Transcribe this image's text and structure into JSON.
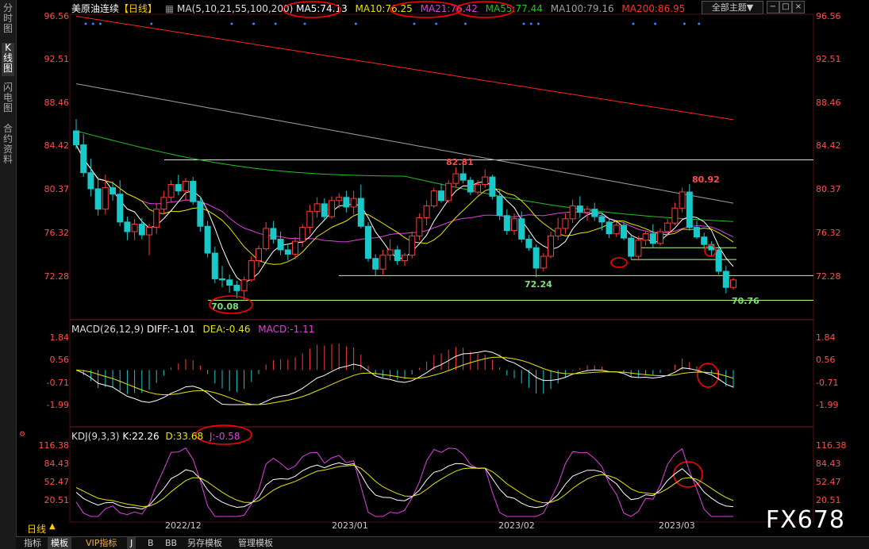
{
  "sidebar": {
    "tabs": [
      {
        "label": "分时图",
        "active": false
      },
      {
        "label": "K线图",
        "active": true
      },
      {
        "label": "闪电图",
        "active": false
      },
      {
        "label": "合约资料",
        "active": false
      }
    ]
  },
  "header": {
    "instrument": "美原油连续",
    "period_tag": "【日线】",
    "ma_params": "MA(5,10,21,55,100,200)",
    "ma5": "MA5:74.13",
    "ma10": "MA10:76.25",
    "ma21": "MA21:76.42",
    "ma55": "MA55:77.44",
    "ma100": "MA100:79.16",
    "ma200": "MA200:86.95",
    "theme_button": "全部主题▼",
    "win_buttons": [
      "−",
      "□",
      "×"
    ]
  },
  "colors": {
    "up": "#ff3b3b",
    "down": "#19c9c9",
    "ma5": "#ffffff",
    "ma10": "#e6e600",
    "ma21": "#e040e0",
    "ma55": "#22c322",
    "ma100": "#a0a0a0",
    "ma200": "#ff2020",
    "level_line": "#b4ff80",
    "annotation_circle": "#ff0000",
    "axis_text": "#ff4d4d"
  },
  "price_axis": [
    "96.56",
    "92.51",
    "88.46",
    "84.42",
    "80.37",
    "76.32",
    "72.28"
  ],
  "price_annotations": [
    {
      "label": "82.81",
      "color": "#ff4d4d"
    },
    {
      "label": "80.92",
      "color": "#ff4d4d"
    },
    {
      "label": "72.24",
      "color": "#7de07d"
    },
    {
      "label": "70.08",
      "color": "#7de07d"
    },
    {
      "label": "70.76",
      "color": "#7de07d"
    }
  ],
  "macd": {
    "title": "MACD(26,12,9)",
    "diff": "DIFF:-1.01",
    "dea": "DEA:-0.46",
    "macd": "MACD:-1.11",
    "axis": [
      "1.84",
      "0.56",
      "-0.71",
      "-1.99"
    ]
  },
  "kdj": {
    "title": "KDJ(9,3,3)",
    "k": "K:22.26",
    "d": "D:33.68",
    "j": "J:-0.58",
    "axis": [
      "116.38",
      "84.43",
      "52.47",
      "20.51"
    ]
  },
  "x_axis_labels": [
    "2022/12",
    "2023/01",
    "2023/02",
    "2023/03"
  ],
  "period_label": "日线",
  "bottom_tabs": [
    {
      "label": "指标",
      "selected": false
    },
    {
      "label": "模板",
      "selected": true
    },
    {
      "label": "VIP指标",
      "selected": false
    },
    {
      "label": "J",
      "selected": true
    },
    {
      "label": "B",
      "selected": false
    },
    {
      "label": "BB",
      "selected": false
    },
    {
      "label": "另存模板",
      "selected": false
    },
    {
      "label": "管理模板",
      "selected": false
    }
  ],
  "watermark": "FX678",
  "chart_data": {
    "type": "candlestick",
    "title": "美原油连续 日线",
    "ylim": [
      68.5,
      97.5
    ],
    "candles": [
      [
        85.9,
        87.0,
        84.2,
        84.6
      ],
      [
        84.6,
        85.6,
        81.6,
        82.0
      ],
      [
        82.0,
        83.3,
        79.8,
        80.5
      ],
      [
        80.5,
        81.6,
        78.0,
        78.6
      ],
      [
        78.6,
        81.8,
        78.1,
        80.6
      ],
      [
        80.6,
        81.2,
        79.4,
        80.0
      ],
      [
        80.0,
        81.3,
        77.0,
        77.4
      ],
      [
        77.4,
        77.9,
        75.7,
        76.5
      ],
      [
        76.5,
        77.7,
        75.7,
        77.2
      ],
      [
        77.2,
        77.8,
        75.8,
        76.2
      ],
      [
        76.2,
        77.2,
        74.3,
        76.9
      ],
      [
        76.9,
        79.2,
        76.3,
        78.6
      ],
      [
        78.6,
        80.3,
        78.1,
        79.7
      ],
      [
        79.7,
        81.3,
        79.2,
        80.9
      ],
      [
        80.9,
        81.8,
        79.9,
        80.3
      ],
      [
        80.3,
        81.5,
        79.4,
        81.2
      ],
      [
        81.2,
        81.6,
        79.0,
        79.3
      ],
      [
        79.3,
        79.8,
        76.5,
        77.0
      ],
      [
        77.0,
        77.5,
        74.1,
        74.5
      ],
      [
        74.5,
        75.1,
        71.7,
        72.1
      ],
      [
        72.1,
        73.3,
        71.3,
        72.0
      ],
      [
        72.0,
        72.5,
        70.8,
        71.5
      ],
      [
        71.5,
        71.9,
        70.3,
        71.0
      ],
      [
        71.0,
        72.3,
        70.08,
        72.0
      ],
      [
        72.0,
        74.2,
        71.8,
        73.8
      ],
      [
        73.8,
        75.2,
        73.2,
        74.9
      ],
      [
        74.9,
        77.4,
        74.7,
        76.8
      ],
      [
        76.8,
        77.5,
        75.4,
        75.8
      ],
      [
        75.8,
        76.5,
        74.3,
        74.8
      ],
      [
        74.8,
        75.4,
        73.8,
        74.4
      ],
      [
        74.4,
        76.0,
        73.9,
        75.6
      ],
      [
        75.6,
        77.2,
        75.1,
        76.9
      ],
      [
        76.9,
        79.0,
        76.3,
        78.4
      ],
      [
        78.4,
        79.7,
        77.8,
        79.1
      ],
      [
        79.1,
        79.6,
        77.6,
        77.9
      ],
      [
        77.9,
        79.8,
        77.7,
        79.4
      ],
      [
        79.4,
        80.1,
        78.7,
        79.7
      ],
      [
        79.7,
        80.3,
        78.3,
        78.8
      ],
      [
        78.8,
        80.3,
        78.1,
        79.6
      ],
      [
        79.6,
        80.9,
        76.8,
        77.0
      ],
      [
        77.0,
        77.4,
        73.7,
        74.0
      ],
      [
        74.0,
        74.4,
        72.4,
        73.0
      ],
      [
        73.0,
        74.8,
        72.5,
        74.3
      ],
      [
        74.3,
        75.8,
        73.8,
        74.8
      ],
      [
        74.8,
        75.2,
        73.4,
        73.8
      ],
      [
        73.8,
        74.5,
        73.3,
        74.3
      ],
      [
        74.3,
        76.5,
        74.0,
        76.1
      ],
      [
        76.1,
        78.2,
        75.7,
        77.8
      ],
      [
        77.8,
        79.4,
        77.1,
        78.9
      ],
      [
        78.9,
        80.6,
        78.7,
        80.3
      ],
      [
        80.3,
        81.0,
        79.2,
        79.4
      ],
      [
        79.4,
        81.3,
        79.2,
        81.0
      ],
      [
        81.0,
        82.5,
        80.6,
        81.9
      ],
      [
        81.9,
        82.81,
        81.0,
        81.3
      ],
      [
        81.3,
        81.6,
        79.9,
        80.2
      ],
      [
        80.2,
        81.3,
        80.0,
        80.9
      ],
      [
        80.9,
        82.3,
        80.6,
        81.6
      ],
      [
        81.6,
        81.8,
        79.5,
        79.8
      ],
      [
        79.8,
        80.4,
        77.6,
        78.0
      ],
      [
        78.0,
        78.6,
        76.2,
        76.6
      ],
      [
        76.6,
        78.2,
        76.2,
        77.7
      ],
      [
        77.7,
        78.4,
        75.5,
        75.8
      ],
      [
        75.8,
        76.2,
        74.7,
        75.0
      ],
      [
        75.0,
        75.3,
        72.24,
        73.1
      ],
      [
        73.1,
        74.5,
        72.8,
        74.2
      ],
      [
        74.2,
        76.5,
        74.0,
        76.1
      ],
      [
        76.1,
        77.8,
        75.7,
        76.8
      ],
      [
        76.8,
        78.2,
        76.3,
        77.7
      ],
      [
        77.7,
        79.5,
        77.3,
        78.9
      ],
      [
        78.9,
        79.8,
        77.8,
        78.3
      ],
      [
        78.3,
        78.9,
        77.5,
        78.6
      ],
      [
        78.6,
        79.2,
        77.5,
        77.9
      ],
      [
        77.9,
        78.3,
        76.6,
        77.4
      ],
      [
        77.4,
        77.7,
        75.9,
        76.3
      ],
      [
        76.3,
        77.4,
        76.0,
        77.1
      ],
      [
        77.1,
        77.4,
        75.7,
        75.9
      ],
      [
        75.9,
        76.3,
        73.9,
        74.2
      ],
      [
        74.2,
        76.1,
        73.8,
        75.7
      ],
      [
        75.7,
        76.6,
        75.2,
        76.3
      ],
      [
        76.3,
        77.2,
        75.0,
        75.4
      ],
      [
        75.4,
        76.8,
        75.2,
        76.5
      ],
      [
        76.5,
        77.7,
        76.1,
        77.3
      ],
      [
        77.3,
        79.2,
        77.1,
        78.7
      ],
      [
        78.7,
        80.6,
        78.3,
        80.2
      ],
      [
        80.2,
        80.92,
        76.6,
        76.9
      ],
      [
        76.9,
        77.5,
        75.8,
        76.0
      ],
      [
        76.0,
        76.4,
        74.9,
        75.3
      ],
      [
        75.3,
        75.6,
        74.2,
        74.8
      ],
      [
        74.8,
        75.2,
        72.5,
        72.8
      ],
      [
        72.8,
        73.3,
        70.76,
        71.3
      ],
      [
        71.3,
        72.2,
        71.1,
        72.0
      ]
    ],
    "ma_series": [
      {
        "name": "MA200",
        "values_start_end": [
          96.6,
          86.95
        ]
      },
      {
        "name": "MA100",
        "values_start_end": [
          90.3,
          79.16
        ]
      },
      {
        "name": "MA55",
        "values_start_end": [
          85.9,
          77.44
        ]
      }
    ],
    "level_lines": [
      83.2,
      75.0,
      73.9,
      72.4,
      70.1
    ],
    "macd_diff_last": -1.01,
    "macd_dea_last": -0.46,
    "macd_hist_last": -1.11,
    "kdj_k_last": 22.26,
    "kdj_d_last": 33.68,
    "kdj_j_last": -0.58
  }
}
